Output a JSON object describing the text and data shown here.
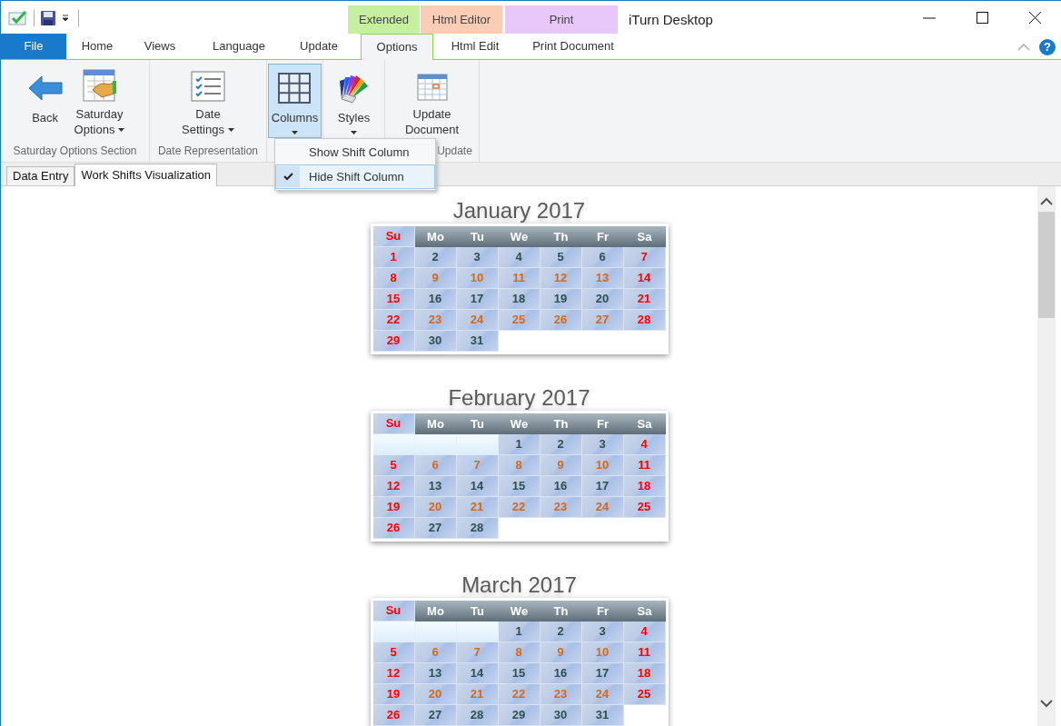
{
  "window": {
    "title": "iTurn Desktop"
  },
  "help": "?",
  "context_groups": [
    {
      "label": "Extended",
      "color": "#c6efa0"
    },
    {
      "label": "Html Editor",
      "color": "#fbcdb5"
    },
    {
      "label": "Print",
      "color": "#e8c8fa"
    }
  ],
  "ribbon_tabs": [
    {
      "label": "File",
      "kind": "file",
      "selected": false
    },
    {
      "label": "Home",
      "kind": "tab",
      "selected": false
    },
    {
      "label": "Views",
      "kind": "tab",
      "selected": false
    },
    {
      "label": "Language",
      "kind": "tab",
      "selected": false
    },
    {
      "label": "Update",
      "kind": "tab",
      "selected": false
    },
    {
      "label": "Options",
      "kind": "tab",
      "selected": true
    },
    {
      "label": "Html Edit",
      "kind": "tab",
      "selected": false
    },
    {
      "label": "Print Document",
      "kind": "tab",
      "selected": false
    }
  ],
  "ribbon_groups": [
    {
      "label": "Saturday Options Section",
      "buttons": [
        {
          "lines": [
            "Back"
          ],
          "dropdown": false,
          "selected": false
        },
        {
          "lines": [
            "Saturday",
            "Options"
          ],
          "dropdown": true,
          "selected": false
        }
      ]
    },
    {
      "label": "Date Representation",
      "buttons": [
        {
          "lines": [
            "Date",
            "Settings"
          ],
          "dropdown": true,
          "selected": false
        }
      ]
    },
    {
      "buttons": [
        {
          "lines": [
            "Columns"
          ],
          "dropdown": true,
          "selected": true
        }
      ]
    },
    {
      "buttons": [
        {
          "lines": [
            "Styles"
          ],
          "dropdown": true,
          "selected": false
        }
      ]
    },
    {
      "label": "Update",
      "buttons": [
        {
          "lines": [
            "Update",
            "Document"
          ],
          "dropdown": false,
          "selected": false
        }
      ]
    }
  ],
  "dropdown_menu": [
    {
      "label": "Show Shift Column",
      "checked": false
    },
    {
      "label": "Hide Shift Column",
      "checked": true
    }
  ],
  "document_tabs": [
    {
      "label": "Data Entry",
      "selected": false
    },
    {
      "label": "Work Shifts Visualization",
      "selected": true
    }
  ],
  "calendars": [
    {
      "title": "January 2017",
      "weekdays": [
        "Su",
        "Mo",
        "Tu",
        "We",
        "Th",
        "Fr",
        "Sa"
      ],
      "weeks": [
        [
          {
            "kind": "day",
            "text": "1",
            "color": "#ff0000"
          },
          {
            "kind": "day",
            "text": "2",
            "color": "#2f4f4f"
          },
          {
            "kind": "day",
            "text": "3",
            "color": "#2f4f4f"
          },
          {
            "kind": "day",
            "text": "4",
            "color": "#2f4f4f"
          },
          {
            "kind": "day",
            "text": "5",
            "color": "#2f4f4f"
          },
          {
            "kind": "day",
            "text": "6",
            "color": "#2f4f4f"
          },
          {
            "kind": "day",
            "text": "7",
            "color": "#ff0000"
          }
        ],
        [
          {
            "kind": "day",
            "text": "8",
            "color": "#ff0000"
          },
          {
            "kind": "day",
            "text": "9",
            "color": "#d2691e"
          },
          {
            "kind": "day",
            "text": "10",
            "color": "#d2691e"
          },
          {
            "kind": "day",
            "text": "11",
            "color": "#d2691e"
          },
          {
            "kind": "day",
            "text": "12",
            "color": "#d2691e"
          },
          {
            "kind": "day",
            "text": "13",
            "color": "#d2691e"
          },
          {
            "kind": "day",
            "text": "14",
            "color": "#ff0000"
          }
        ],
        [
          {
            "kind": "day",
            "text": "15",
            "color": "#ff0000"
          },
          {
            "kind": "day",
            "text": "16",
            "color": "#2f4f4f"
          },
          {
            "kind": "day",
            "text": "17",
            "color": "#2f4f4f"
          },
          {
            "kind": "day",
            "text": "18",
            "color": "#2f4f4f"
          },
          {
            "kind": "day",
            "text": "19",
            "color": "#2f4f4f"
          },
          {
            "kind": "day",
            "text": "20",
            "color": "#2f4f4f"
          },
          {
            "kind": "day",
            "text": "21",
            "color": "#ff0000"
          }
        ],
        [
          {
            "kind": "day",
            "text": "22",
            "color": "#ff0000"
          },
          {
            "kind": "day",
            "text": "23",
            "color": "#d2691e"
          },
          {
            "kind": "day",
            "text": "24",
            "color": "#d2691e"
          },
          {
            "kind": "day",
            "text": "25",
            "color": "#d2691e"
          },
          {
            "kind": "day",
            "text": "26",
            "color": "#d2691e"
          },
          {
            "kind": "day",
            "text": "27",
            "color": "#d2691e"
          },
          {
            "kind": "day",
            "text": "28",
            "color": "#ff0000"
          }
        ],
        [
          {
            "kind": "day",
            "text": "29",
            "color": "#ff0000"
          },
          {
            "kind": "day",
            "text": "30",
            "color": "#2f4f4f"
          },
          {
            "kind": "day",
            "text": "31",
            "color": "#2f4f4f"
          }
        ]
      ]
    },
    {
      "title": "February 2017",
      "weekdays": [
        "Su",
        "Mo",
        "Tu",
        "We",
        "Th",
        "Fr",
        "Sa"
      ],
      "weeks": [
        [
          {
            "kind": "blank"
          },
          {
            "kind": "blank"
          },
          {
            "kind": "blank"
          },
          {
            "kind": "day",
            "text": "1",
            "color": "#2f4f4f"
          },
          {
            "kind": "day",
            "text": "2",
            "color": "#2f4f4f"
          },
          {
            "kind": "day",
            "text": "3",
            "color": "#2f4f4f"
          },
          {
            "kind": "day",
            "text": "4",
            "color": "#ff0000"
          }
        ],
        [
          {
            "kind": "day",
            "text": "5",
            "color": "#ff0000"
          },
          {
            "kind": "day",
            "text": "6",
            "color": "#d2691e"
          },
          {
            "kind": "day",
            "text": "7",
            "color": "#d2691e"
          },
          {
            "kind": "day",
            "text": "8",
            "color": "#d2691e"
          },
          {
            "kind": "day",
            "text": "9",
            "color": "#d2691e"
          },
          {
            "kind": "day",
            "text": "10",
            "color": "#d2691e"
          },
          {
            "kind": "day",
            "text": "11",
            "color": "#ff0000"
          }
        ],
        [
          {
            "kind": "day",
            "text": "12",
            "color": "#ff0000"
          },
          {
            "kind": "day",
            "text": "13",
            "color": "#2f4f4f"
          },
          {
            "kind": "day",
            "text": "14",
            "color": "#2f4f4f"
          },
          {
            "kind": "day",
            "text": "15",
            "color": "#2f4f4f"
          },
          {
            "kind": "day",
            "text": "16",
            "color": "#2f4f4f"
          },
          {
            "kind": "day",
            "text": "17",
            "color": "#2f4f4f"
          },
          {
            "kind": "day",
            "text": "18",
            "color": "#ff0000"
          }
        ],
        [
          {
            "kind": "day",
            "text": "19",
            "color": "#ff0000"
          },
          {
            "kind": "day",
            "text": "20",
            "color": "#d2691e"
          },
          {
            "kind": "day",
            "text": "21",
            "color": "#d2691e"
          },
          {
            "kind": "day",
            "text": "22",
            "color": "#d2691e"
          },
          {
            "kind": "day",
            "text": "23",
            "color": "#d2691e"
          },
          {
            "kind": "day",
            "text": "24",
            "color": "#d2691e"
          },
          {
            "kind": "day",
            "text": "25",
            "color": "#ff0000"
          }
        ],
        [
          {
            "kind": "day",
            "text": "26",
            "color": "#ff0000"
          },
          {
            "kind": "day",
            "text": "27",
            "color": "#2f4f4f"
          },
          {
            "kind": "day",
            "text": "28",
            "color": "#2f4f4f"
          }
        ]
      ]
    },
    {
      "title": "March 2017",
      "weekdays": [
        "Su",
        "Mo",
        "Tu",
        "We",
        "Th",
        "Fr",
        "Sa"
      ],
      "weeks": [
        [
          {
            "kind": "blank"
          },
          {
            "kind": "blank"
          },
          {
            "kind": "blank"
          },
          {
            "kind": "day",
            "text": "1",
            "color": "#2f4f4f"
          },
          {
            "kind": "day",
            "text": "2",
            "color": "#2f4f4f"
          },
          {
            "kind": "day",
            "text": "3",
            "color": "#2f4f4f"
          },
          {
            "kind": "day",
            "text": "4",
            "color": "#ff0000"
          }
        ],
        [
          {
            "kind": "day",
            "text": "5",
            "color": "#ff0000"
          },
          {
            "kind": "day",
            "text": "6",
            "color": "#d2691e"
          },
          {
            "kind": "day",
            "text": "7",
            "color": "#d2691e"
          },
          {
            "kind": "day",
            "text": "8",
            "color": "#d2691e"
          },
          {
            "kind": "day",
            "text": "9",
            "color": "#d2691e"
          },
          {
            "kind": "day",
            "text": "10",
            "color": "#d2691e"
          },
          {
            "kind": "day",
            "text": "11",
            "color": "#ff0000"
          }
        ],
        [
          {
            "kind": "day",
            "text": "12",
            "color": "#ff0000"
          },
          {
            "kind": "day",
            "text": "13",
            "color": "#2f4f4f"
          },
          {
            "kind": "day",
            "text": "14",
            "color": "#2f4f4f"
          },
          {
            "kind": "day",
            "text": "15",
            "color": "#2f4f4f"
          },
          {
            "kind": "day",
            "text": "16",
            "color": "#2f4f4f"
          },
          {
            "kind": "day",
            "text": "17",
            "color": "#2f4f4f"
          },
          {
            "kind": "day",
            "text": "18",
            "color": "#ff0000"
          }
        ],
        [
          {
            "kind": "day",
            "text": "19",
            "color": "#ff0000"
          },
          {
            "kind": "day",
            "text": "20",
            "color": "#d2691e"
          },
          {
            "kind": "day",
            "text": "21",
            "color": "#d2691e"
          },
          {
            "kind": "day",
            "text": "22",
            "color": "#d2691e"
          },
          {
            "kind": "day",
            "text": "23",
            "color": "#d2691e"
          },
          {
            "kind": "day",
            "text": "24",
            "color": "#d2691e"
          },
          {
            "kind": "day",
            "text": "25",
            "color": "#ff0000"
          }
        ],
        [
          {
            "kind": "day",
            "text": "26",
            "color": "#ff0000"
          },
          {
            "kind": "day",
            "text": "27",
            "color": "#2f4f4f"
          },
          {
            "kind": "day",
            "text": "28",
            "color": "#2f4f4f"
          },
          {
            "kind": "day",
            "text": "29",
            "color": "#2f4f4f"
          },
          {
            "kind": "day",
            "text": "30",
            "color": "#2f4f4f"
          },
          {
            "kind": "day",
            "text": "31",
            "color": "#2f4f4f"
          }
        ]
      ]
    }
  ]
}
